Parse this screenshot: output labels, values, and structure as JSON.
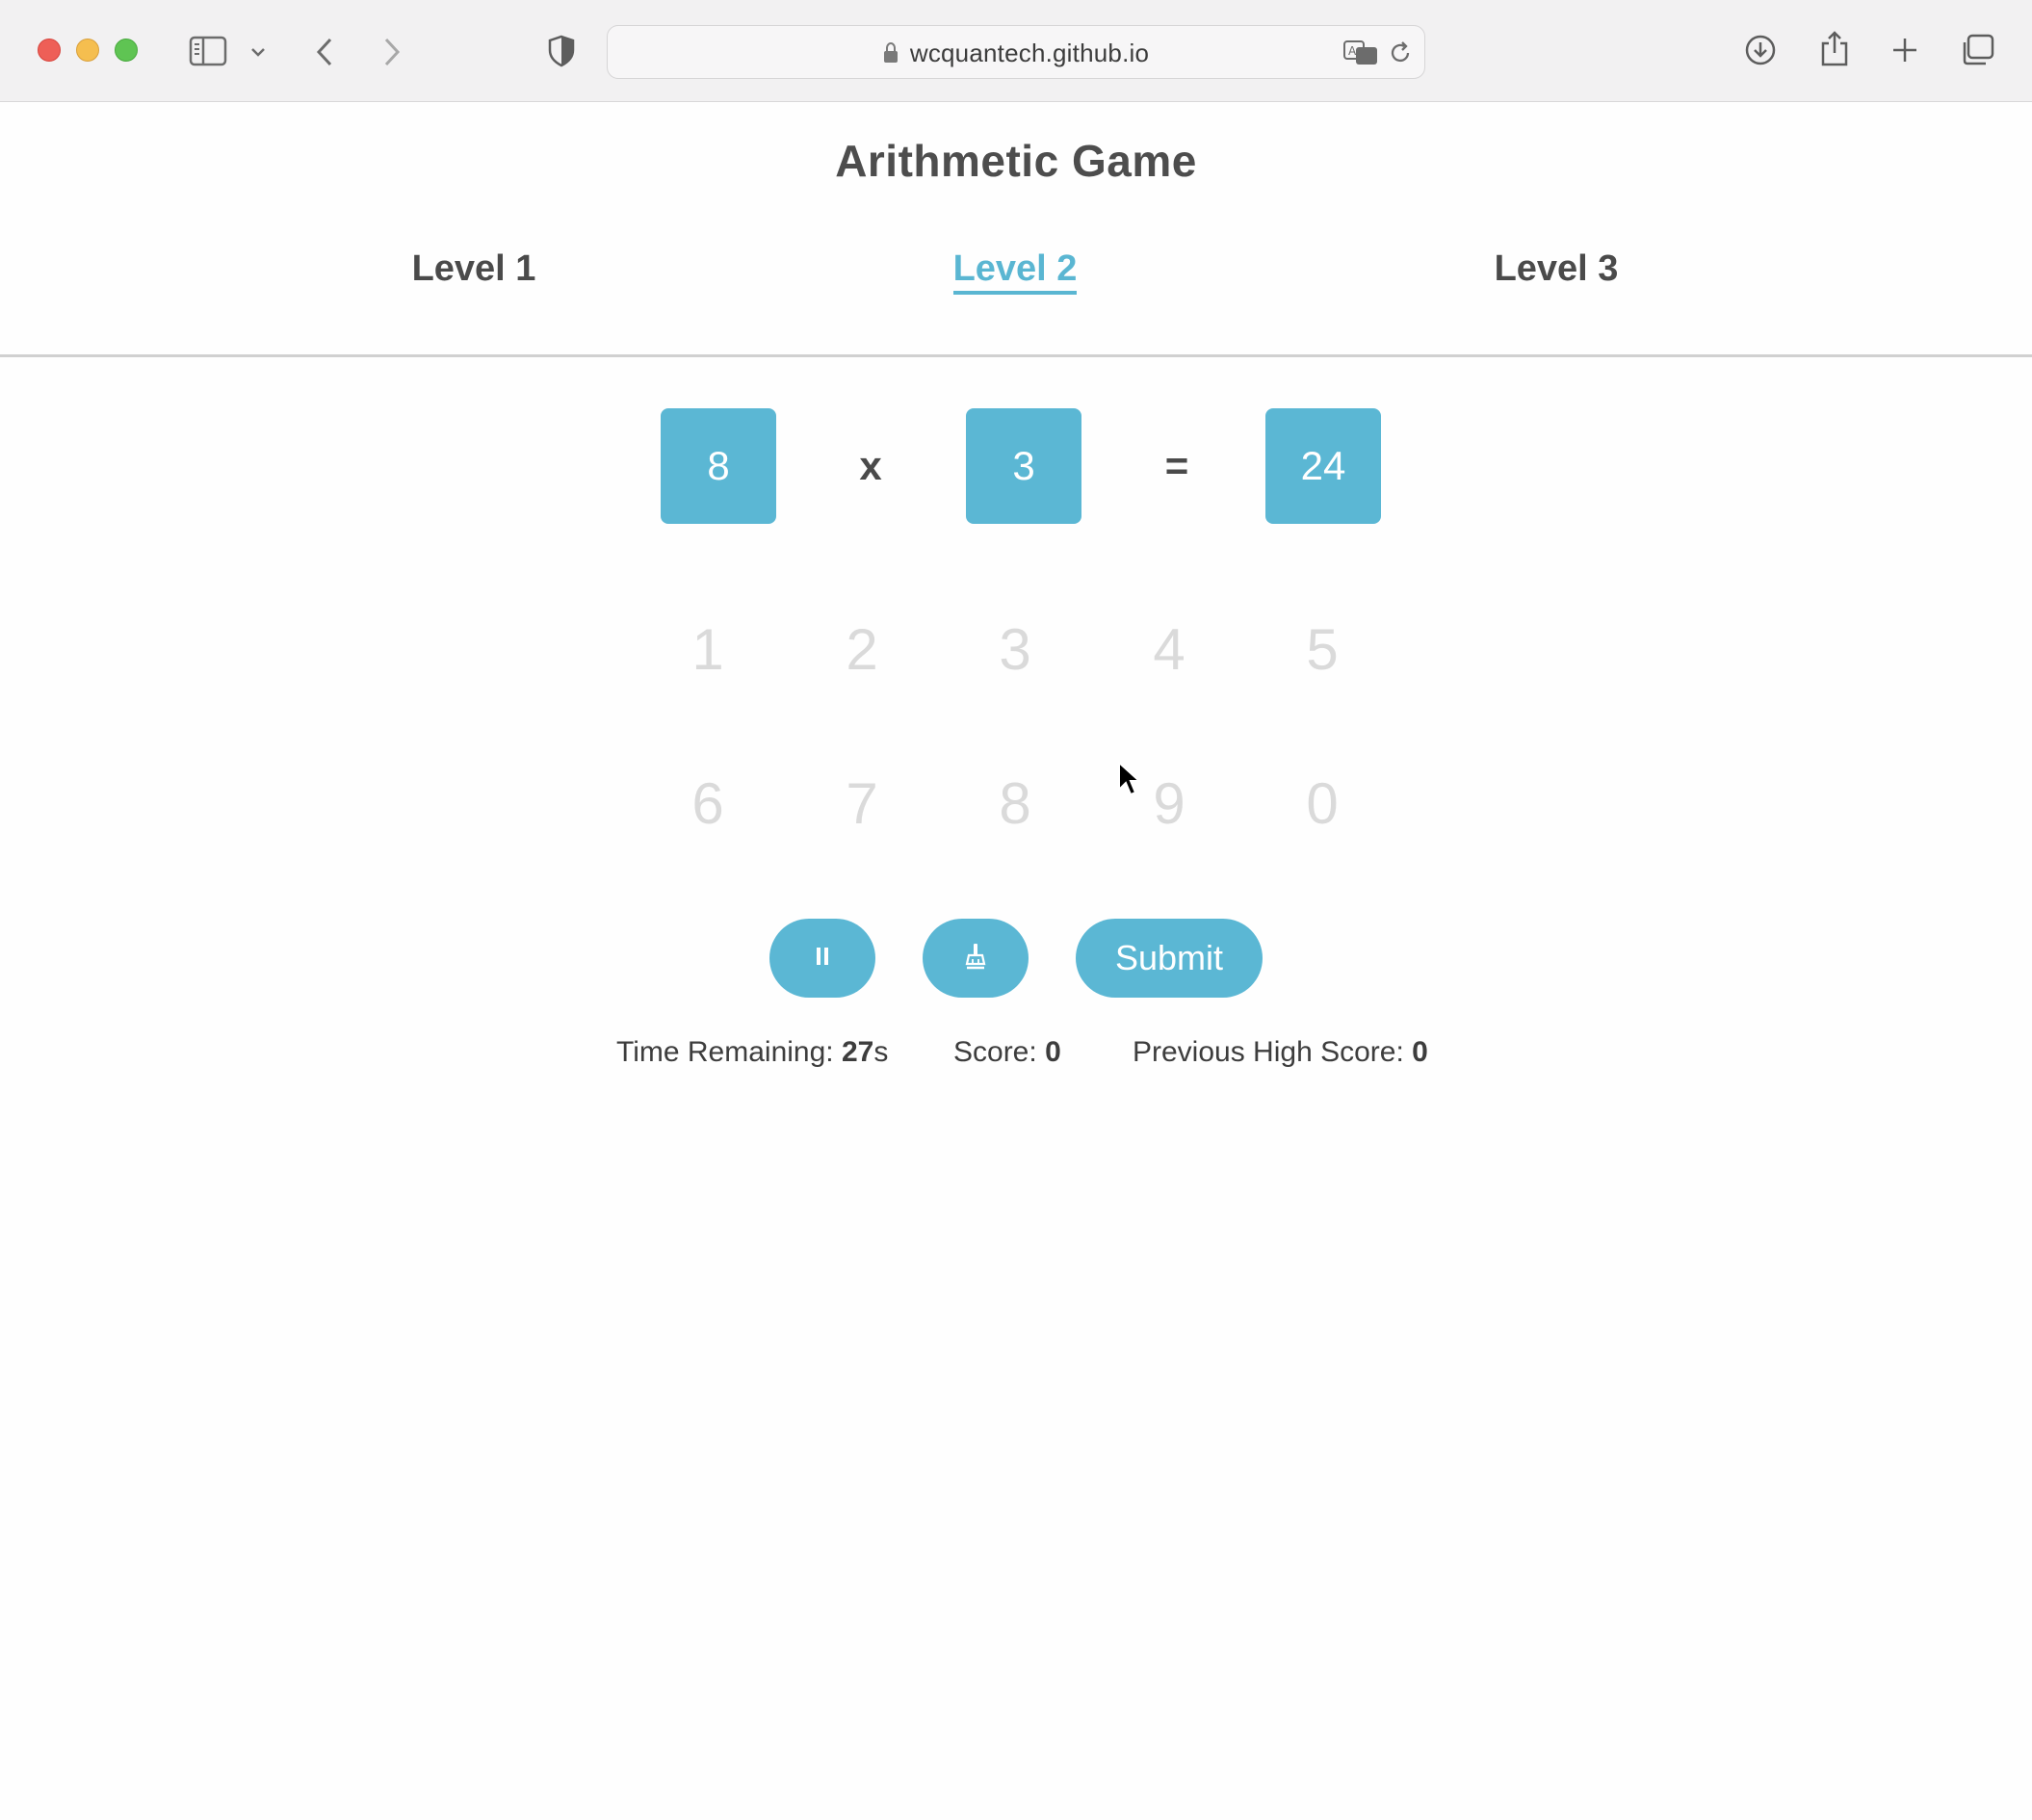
{
  "browser": {
    "url": "wcquantech.github.io",
    "icons": {
      "sidebar": "sidebar-icon",
      "chevron": "chevron-down-icon",
      "back": "back-arrow-icon",
      "forward": "forward-arrow-icon",
      "shield": "privacy-shield-icon",
      "lock": "lock-icon",
      "translate": "translate-icon",
      "reload": "reload-icon",
      "download": "download-icon",
      "share": "share-icon",
      "new_tab": "plus-icon",
      "tabs": "tab-overview-icon"
    }
  },
  "page": {
    "title": "Arithmetic Game",
    "tabs": [
      {
        "label": "Level 1",
        "active": false
      },
      {
        "label": "Level 2",
        "active": true
      },
      {
        "label": "Level 3",
        "active": false
      }
    ],
    "equation": {
      "operand1": "8",
      "operator": "x",
      "operand2": "3",
      "equals": "=",
      "answer": "24"
    },
    "keypad": {
      "row1": [
        "1",
        "2",
        "3",
        "4",
        "5"
      ],
      "row2": [
        "6",
        "7",
        "8",
        "9",
        "0"
      ]
    },
    "controls": {
      "pause_icon": "pause-icon",
      "clear_icon": "broom-icon",
      "submit_label": "Submit"
    },
    "stats": {
      "time_label": "Time Remaining:",
      "time_value": "27",
      "time_unit": "s",
      "score_label": "Score:",
      "score_value": "0",
      "high_score_label": "Previous High Score:",
      "high_score_value": "0"
    }
  },
  "colors": {
    "accent": "#5bb7d4",
    "title_text": "#4d4d4d",
    "keypad_digit": "#dadada"
  }
}
